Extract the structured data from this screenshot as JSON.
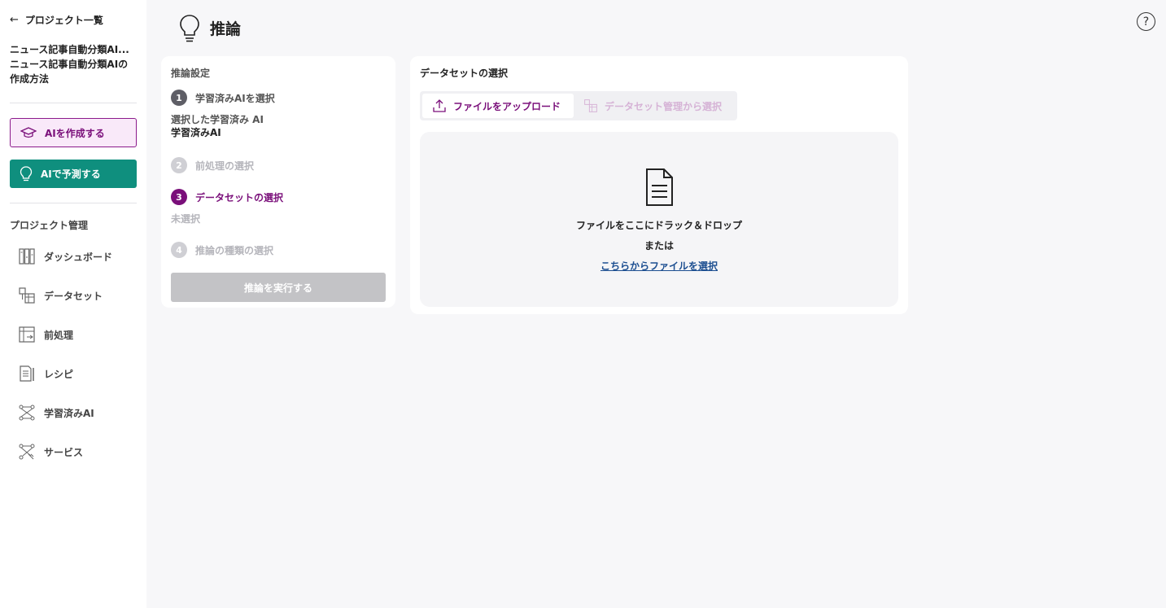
{
  "sidebar": {
    "back_label": "プロジェクト一覧",
    "project_title": "ニュース記事自動分類AI...",
    "project_subtitle_line1": "ニュース記事自動分類AIの",
    "project_subtitle_line2": "作成方法",
    "create_ai_label": "AIを作成する",
    "predict_ai_label": "AIで予測する",
    "section_label": "プロジェクト管理",
    "items": [
      {
        "label": "ダッシュボード",
        "icon": "dashboard-icon"
      },
      {
        "label": "データセット",
        "icon": "dataset-icon"
      },
      {
        "label": "前処理",
        "icon": "preprocess-icon"
      },
      {
        "label": "レシピ",
        "icon": "recipe-icon"
      },
      {
        "label": "学習済みAI",
        "icon": "trained-ai-icon"
      },
      {
        "label": "サービス",
        "icon": "service-icon"
      }
    ]
  },
  "header": {
    "title": "推論",
    "help": "?"
  },
  "settings": {
    "title": "推論設定",
    "steps": [
      {
        "num": "1",
        "label": "学習済みAIを選択",
        "state": "done"
      },
      {
        "num": "2",
        "label": "前処理の選択",
        "state": "inactive"
      },
      {
        "num": "3",
        "label": "データセットの選択",
        "state": "active"
      },
      {
        "num": "4",
        "label": "推論の種類の選択",
        "state": "inactive"
      }
    ],
    "selected_ai_label": "選択した学習済み AI",
    "selected_ai_value": "学習済みAI",
    "dataset_unselected": "未選択",
    "run_label": "推論を実行する"
  },
  "dataset": {
    "title": "データセットの選択",
    "tab_upload": "ファイルをアップロード",
    "tab_manage": "データセット管理から選択",
    "drop_text": "ファイルをここにドラック＆ドロップ",
    "or_text": "または",
    "link_text": "こちらからファイルを選択"
  },
  "colors": {
    "accent_purple": "#7a0f7a",
    "teal": "#0f8f7e",
    "link_blue": "#1d4f91"
  }
}
